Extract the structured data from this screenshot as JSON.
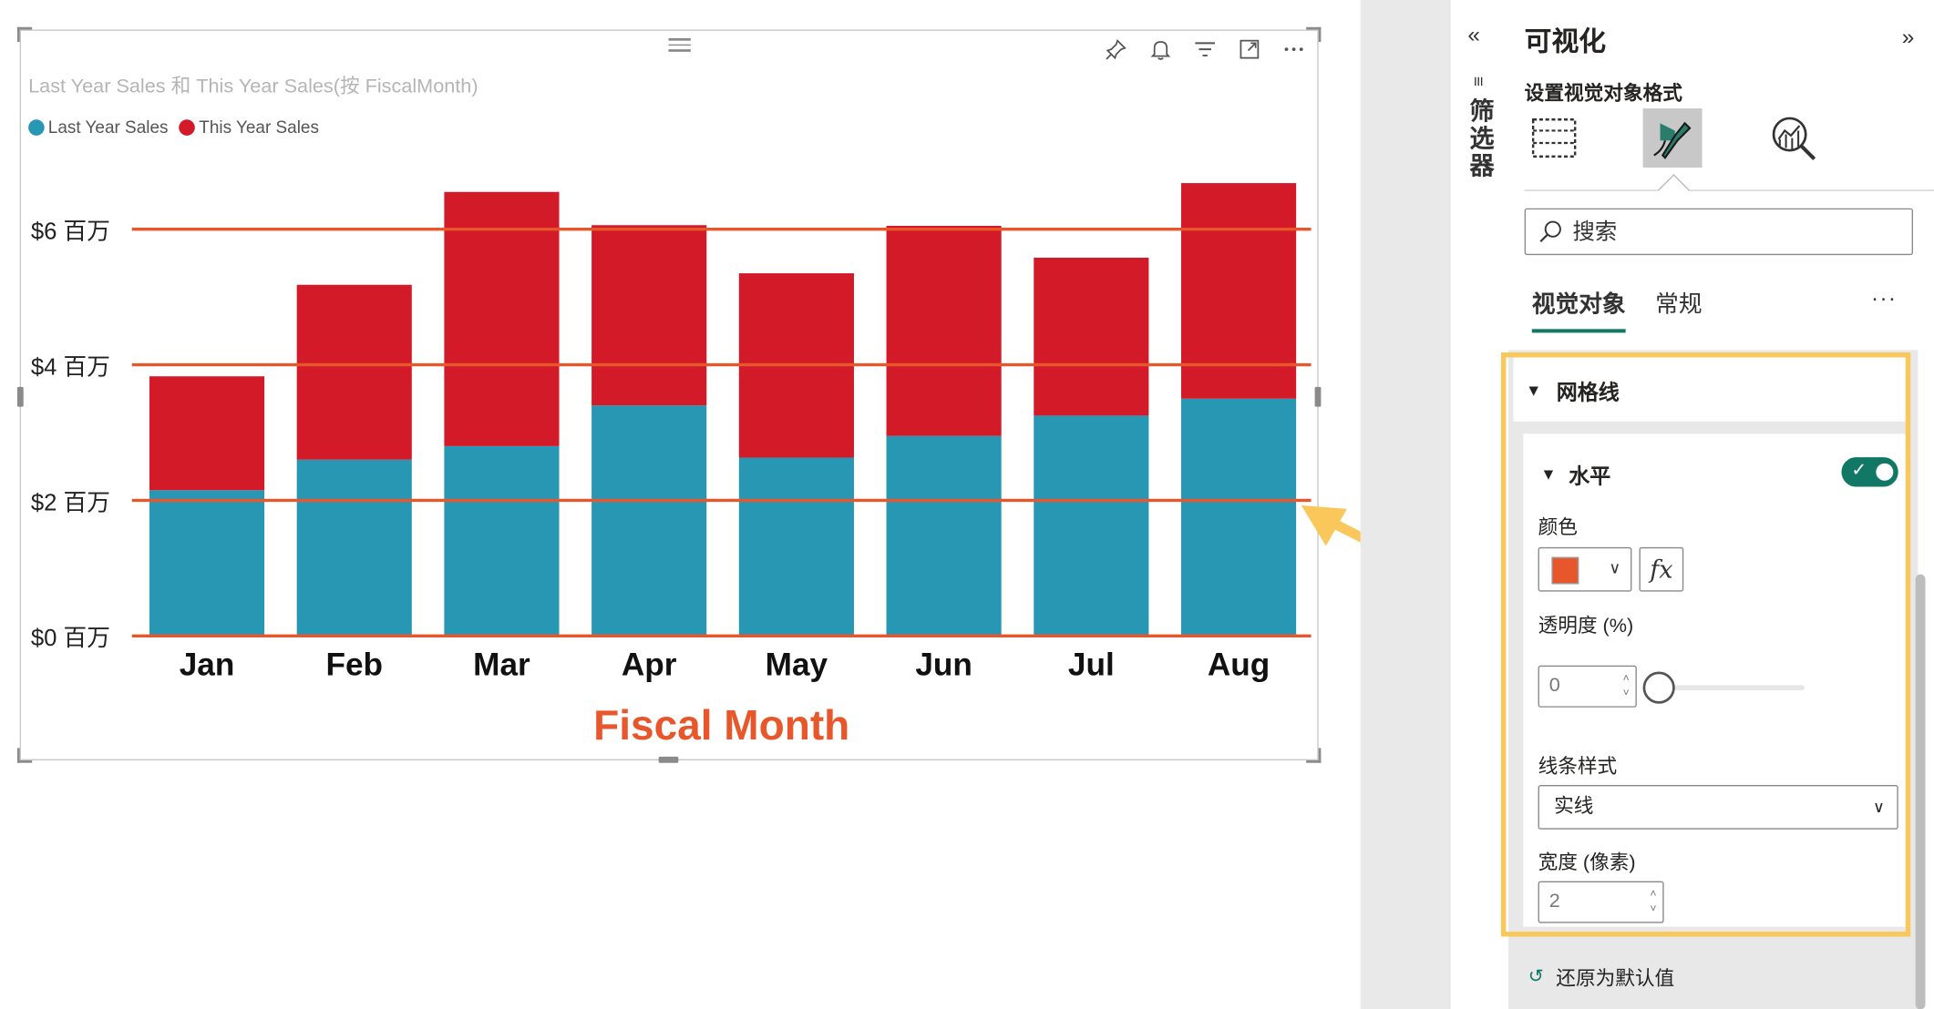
{
  "visual": {
    "title": "Last Year Sales 和 This Year Sales(按 FiscalMonth)",
    "header_icons": [
      "pin-icon",
      "bell-icon",
      "filter-icon",
      "focus-mode-icon",
      "more-options-icon"
    ]
  },
  "colors": {
    "last_year": "#2897b4",
    "this_year": "#d31a28",
    "gridline": "#e8572b",
    "axis_title": "#e8572b",
    "accent": "#117865",
    "highlight": "#f9c75a"
  },
  "chart_data": {
    "type": "bar",
    "stacked": true,
    "categories": [
      "Jan",
      "Feb",
      "Mar",
      "Apr",
      "May",
      "Jun",
      "Jul",
      "Aug"
    ],
    "series": [
      {
        "name": "Last Year Sales",
        "values": [
          2.15,
          2.6,
          2.8,
          3.4,
          2.63,
          2.95,
          3.25,
          3.5
        ]
      },
      {
        "name": "This Year Sales",
        "values": [
          1.68,
          2.58,
          3.75,
          2.66,
          2.72,
          3.1,
          2.33,
          3.18
        ]
      }
    ],
    "yticks": [
      "$0 百万",
      "$2 百万",
      "$4 百万",
      "$6 百万"
    ],
    "ylim": [
      0,
      7.2
    ],
    "xlabel": "Fiscal Month",
    "legend_position": "top-left",
    "grid": "horizontal"
  },
  "filter_pane": {
    "collapse_icon": "«",
    "label": "筛选器"
  },
  "pane": {
    "title": "可视化",
    "expand_icon": "»",
    "subtitle": "设置视觉对象格式",
    "search_placeholder": "搜索",
    "tabs": [
      "视觉对象",
      "常规"
    ],
    "more": "···",
    "section": "网格线",
    "subsection": "水平",
    "toggle_on": true,
    "color_label": "颜色",
    "fx_label": "fx",
    "transparency_label": "透明度 (%)",
    "transparency_value": "0",
    "line_style_label": "线条样式",
    "line_style_value": "实线",
    "width_label": "宽度 (像素)",
    "width_value": "2",
    "reset_label": "还原为默认值"
  }
}
